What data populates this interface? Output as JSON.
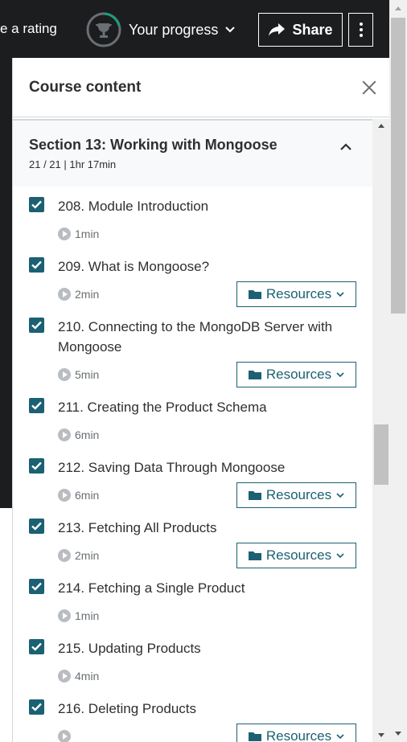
{
  "topbar": {
    "rating_text": "e a rating",
    "progress_label": "Your progress",
    "share_label": "Share"
  },
  "panel": {
    "title": "Course content",
    "section": {
      "title": "Section 13: Working with Mongoose",
      "meta": "21 / 21 | 1hr 17min"
    },
    "items": [
      {
        "title": "208. Module Introduction",
        "duration": "1min",
        "resources": ""
      },
      {
        "title": "209. What is Mongoose?",
        "duration": "2min",
        "resources": "Resources"
      },
      {
        "title": "210. Connecting to the MongoDB Server with Mongoose",
        "duration": "5min",
        "resources": "Resources"
      },
      {
        "title": "211. Creating the Product Schema",
        "duration": "6min",
        "resources": ""
      },
      {
        "title": "212. Saving Data Through Mongoose",
        "duration": "6min",
        "resources": "Resources"
      },
      {
        "title": "213. Fetching All Products",
        "duration": "2min",
        "resources": "Resources"
      },
      {
        "title": "214. Fetching a Single Product",
        "duration": "1min",
        "resources": ""
      },
      {
        "title": "215. Updating Products",
        "duration": "4min",
        "resources": ""
      },
      {
        "title": "216. Deleting Products",
        "duration": "",
        "resources": "Resources"
      }
    ]
  },
  "colors": {
    "accent": "#1b6173",
    "topbar_bg": "#1c1d1f",
    "section_bg": "#f7f9fa"
  },
  "icons": [
    "trophy-icon",
    "chevron-down-icon",
    "share-icon",
    "more-icon",
    "close-icon",
    "chevron-up-icon",
    "checkbox-icon",
    "play-icon",
    "folder-icon"
  ]
}
